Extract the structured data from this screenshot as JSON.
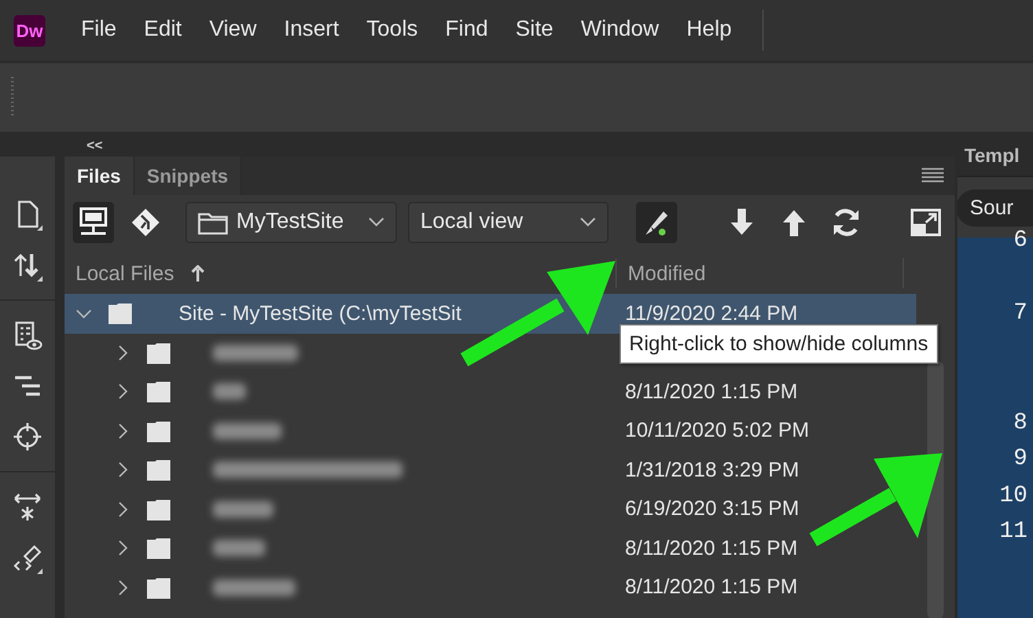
{
  "app": {
    "logo": "Dw"
  },
  "menu": [
    "File",
    "Edit",
    "View",
    "Insert",
    "Tools",
    "Find",
    "Site",
    "Window",
    "Help"
  ],
  "collapse_toggle": "<<",
  "panel": {
    "tabs": [
      {
        "label": "Files",
        "selected": true
      },
      {
        "label": "Snippets",
        "selected": false
      }
    ],
    "site_select": {
      "value": "MyTestSite"
    },
    "view_select": {
      "value": "Local view"
    },
    "columns": [
      "Local Files",
      "Modified"
    ],
    "tree": [
      {
        "name": "Site - MyTestSite (C:\\myTestSit",
        "modified": "11/9/2020 2:44 PM",
        "expanded": true,
        "selected": true,
        "children": [
          {
            "expanded": false,
            "selected": false
          },
          {
            "modified": "8/11/2020 1:15 PM",
            "expanded": false,
            "selected": false
          },
          {
            "modified": "10/11/2020 5:02 PM",
            "expanded": false,
            "selected": false
          },
          {
            "modified": "1/31/2018 3:29 PM",
            "expanded": false,
            "selected": false
          },
          {
            "modified": "6/19/2020 3:15 PM",
            "expanded": false,
            "selected": false
          },
          {
            "modified": "8/11/2020 1:15 PM",
            "expanded": false,
            "selected": false
          },
          {
            "modified": "8/11/2020 1:15 PM",
            "expanded": false,
            "selected": false
          }
        ]
      }
    ],
    "tooltip": "Right-click to show/hide columns"
  },
  "editor": {
    "tab": "Templ",
    "view_button": "Sour",
    "line_numbers": [
      "6",
      "7",
      "8",
      "9",
      "10",
      "11"
    ]
  }
}
